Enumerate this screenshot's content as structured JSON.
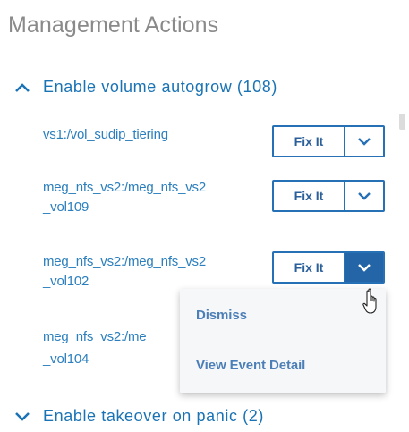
{
  "panel": {
    "title": "Management Actions"
  },
  "sections": [
    {
      "label": "Enable volume autogrow (108)",
      "expanded": true
    },
    {
      "label": "Enable takeover on panic (2)",
      "expanded": false
    }
  ],
  "volumes": [
    {
      "line1": "vs1:/vol_sudip_tiering",
      "line2": ""
    },
    {
      "line1": "meg_nfs_vs2:/meg_nfs_vs2",
      "line2": "_vol109"
    },
    {
      "line1": "meg_nfs_vs2:/meg_nfs_vs2",
      "line2": "_vol102"
    },
    {
      "line1": "meg_nfs_vs2:/me",
      "line2": "_vol104"
    }
  ],
  "actions": {
    "fix_label": "Fix It"
  },
  "dropdown_menu": {
    "items": [
      "Dismiss",
      "View Event Detail"
    ]
  },
  "colors": {
    "link": "#2b7fbe",
    "button_border": "#2670b5",
    "active_dropdown": "#2465a8",
    "title": "#8a8a8a"
  },
  "icons": {
    "expand": "chevron-up-icon",
    "collapse": "chevron-down-icon",
    "cursor": "hand-pointer-icon"
  }
}
